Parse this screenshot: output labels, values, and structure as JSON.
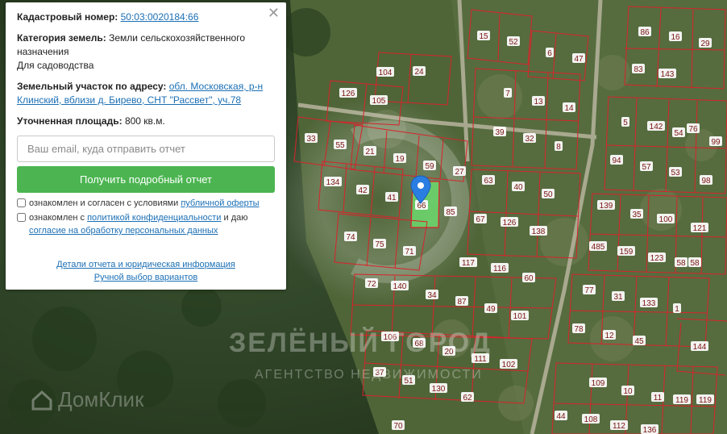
{
  "panel": {
    "cadastral_label": "Кадастровый номер:",
    "cadastral_value": "50:03:0020184:66",
    "category_label": "Категория земель:",
    "category_value": "Земли сельскохозяйственного назначения",
    "category_use": "Для садоводства",
    "address_label": "Земельный участок по адресу:",
    "address_value": "обл. Московская, р-н Клинский, вблизи д. Бирево, СНТ \"Рассвет\", уч.78",
    "area_label": "Уточненная площадь:",
    "area_value": "800 кв.м.",
    "email_placeholder": "Ваш email, куда отправить отчет",
    "submit_label": "Получить подробный отчет",
    "consent1_text": "ознакомлен и согласен с условиями",
    "consent1_link": "публичной оферты",
    "consent2_text": "ознакомлен с",
    "consent2_link": "политикой конфиденциальности",
    "consent2_tail": "и даю",
    "consent2_link2": "согласие на обработку персональных данных",
    "details_link": "Детали отчета и юридическая информация",
    "manual_link": "Ручной выбор вариантов",
    "close_glyph": "✕"
  },
  "map": {
    "plot_labels": [
      "15",
      "52",
      "6",
      "47",
      "86",
      "16",
      "29",
      "104",
      "24",
      "83",
      "143",
      "126",
      "105",
      "7",
      "13",
      "14",
      "5",
      "142",
      "54",
      "76",
      "33",
      "55",
      "21",
      "39",
      "32",
      "8",
      "99",
      "94",
      "57",
      "53",
      "98",
      "19",
      "59",
      "27",
      "134",
      "42",
      "41",
      "63",
      "40",
      "50",
      "66",
      "85",
      "67",
      "126",
      "138",
      "139",
      "35",
      "100",
      "121",
      "74",
      "75",
      "71",
      "117",
      "116",
      "60",
      "485",
      "159",
      "123",
      "58",
      "58",
      "72",
      "140",
      "34",
      "87",
      "49",
      "101",
      "77",
      "31",
      "133",
      "1",
      "78",
      "12",
      "45",
      "106",
      "68",
      "20",
      "111",
      "102",
      "144",
      "37",
      "51",
      "130",
      "62",
      "109",
      "10",
      "11",
      "119",
      "119",
      "70",
      "44",
      "108",
      "112",
      "136"
    ],
    "watermark_title": "ЗЕЛЁНЫЙ ГОРОД",
    "watermark_sub": "АГЕНТСТВО НЕДВИЖИМОСТИ",
    "watermark_brand": "ДомКлик",
    "colors": {
      "plot_line": "#d8232a",
      "selected_plot": "#6bd86b",
      "marker": "#2a7de1",
      "forest": "#2f4a24"
    }
  }
}
